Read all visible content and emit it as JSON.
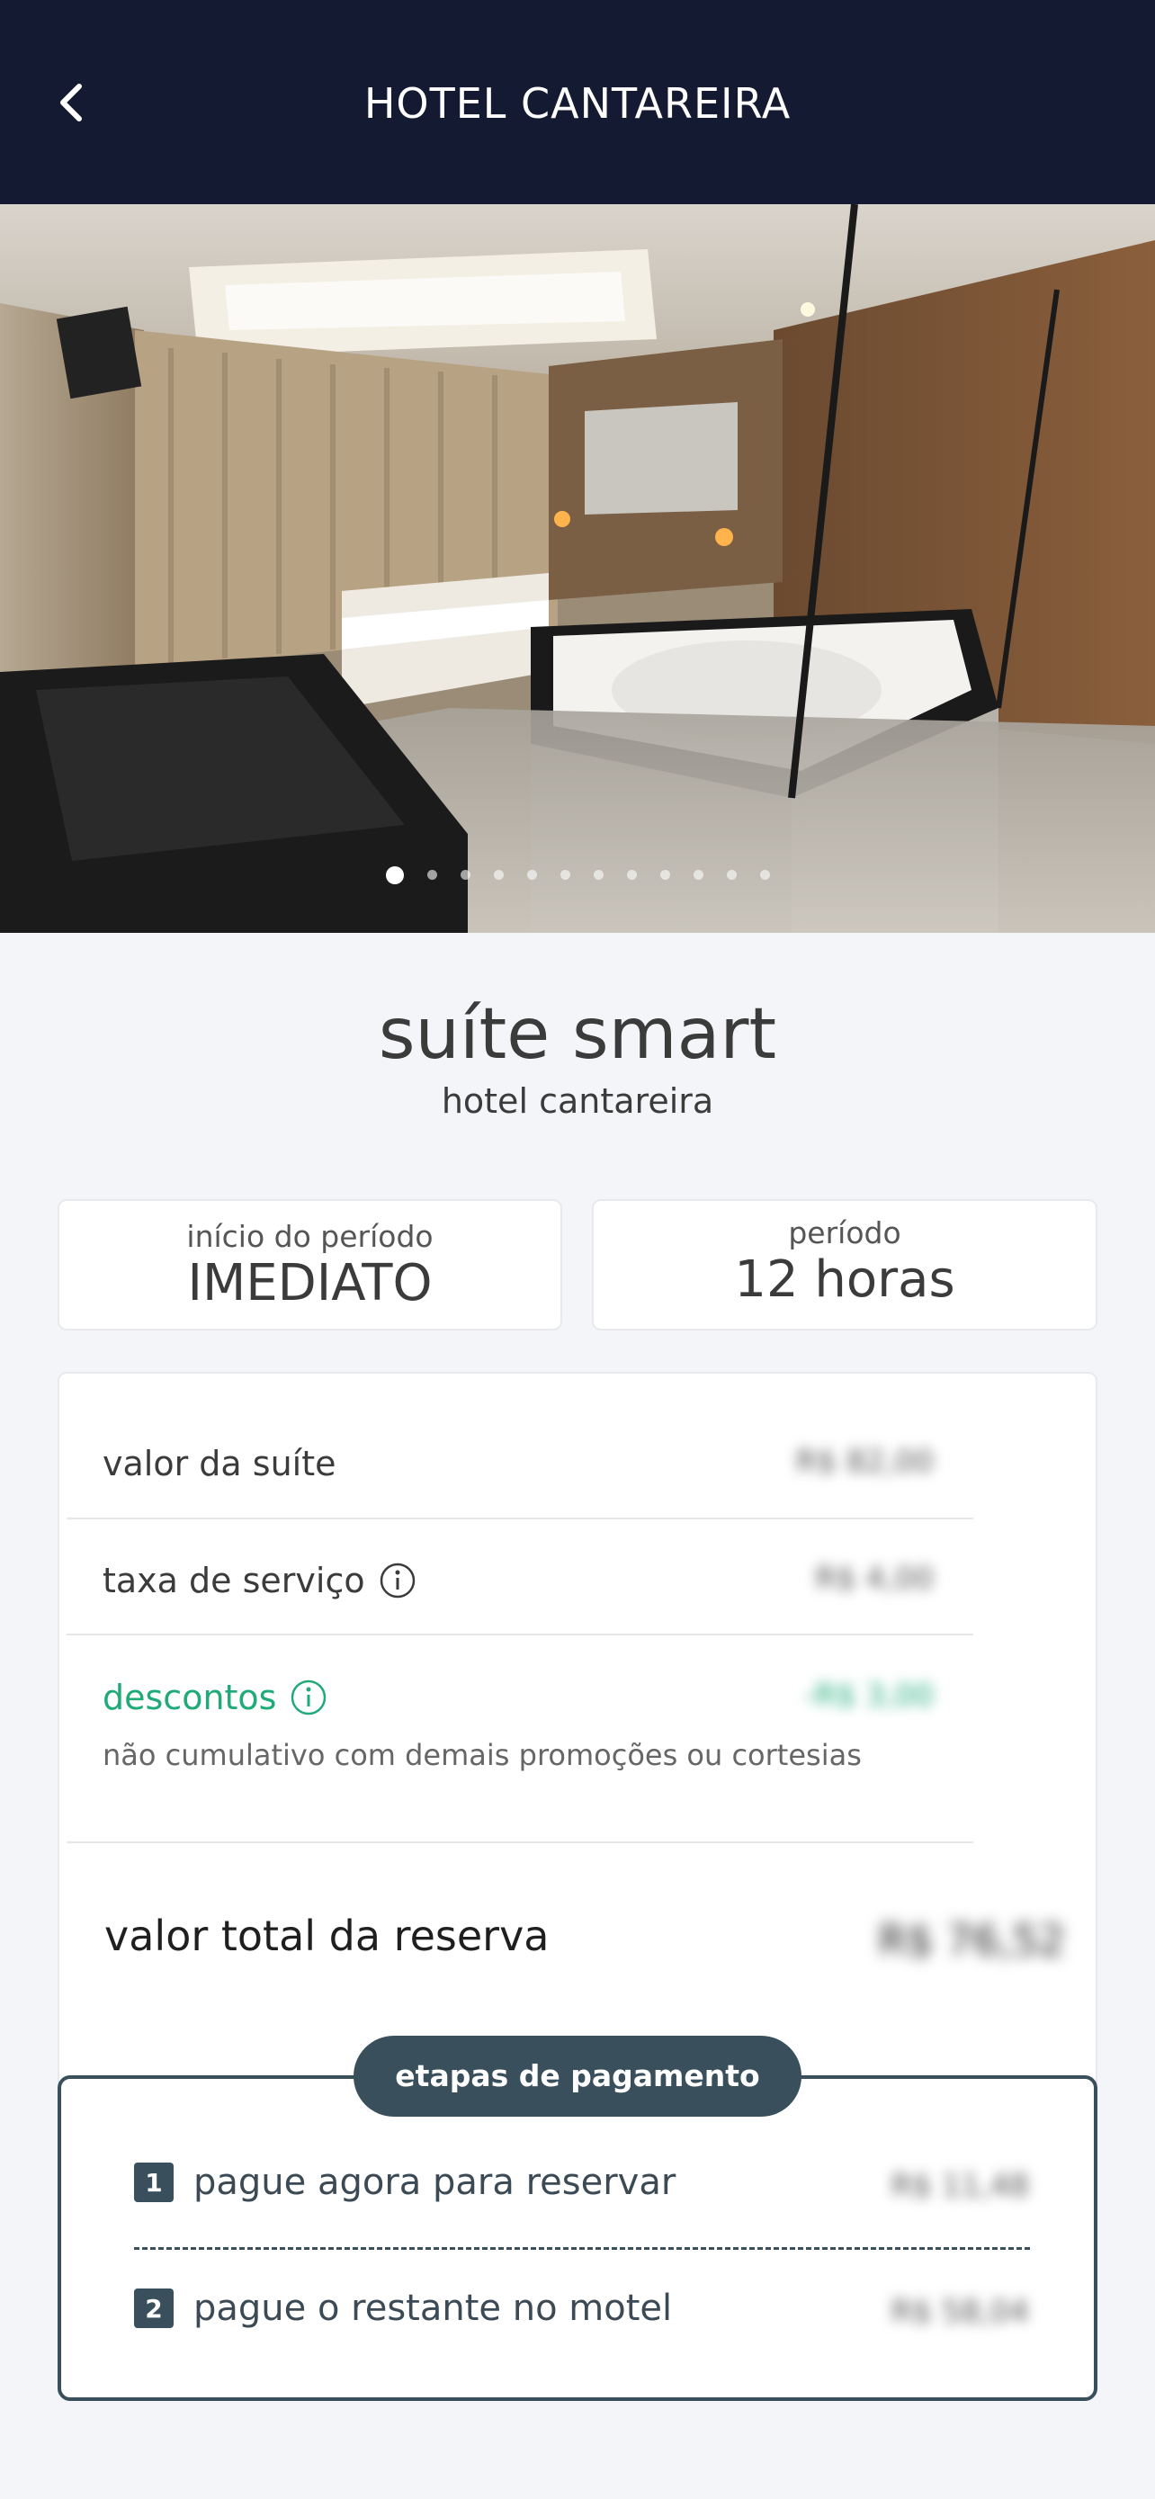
{
  "header": {
    "title": "HOTEL CANTAREIRA",
    "back_icon": "chevron-left-icon"
  },
  "gallery": {
    "slide_count": 12,
    "active_index": 0
  },
  "suite": {
    "name": "suíte smart",
    "hotel": "hotel cantareira"
  },
  "period": {
    "start_label": "início do período",
    "start_value": "IMEDIATO",
    "duration_label": "período",
    "duration_value": "12 horas"
  },
  "pricing": {
    "suite_value_label": "valor da suíte",
    "suite_value": "R$ 82,00",
    "service_fee_label": "taxa de serviço",
    "service_fee": "R$ 4,00",
    "discounts_label": "descontos",
    "discounts_value": "-R$ 3,00",
    "discounts_note": "não cumulativo com demais promoções ou cortesias",
    "total_label": "valor total da reserva",
    "total_value": "R$ 76,52"
  },
  "payment_steps": {
    "title": "etapas de pagamento",
    "steps": [
      {
        "number": "1",
        "label": "pague agora para reservar",
        "value": "R$ 11,48"
      },
      {
        "number": "2",
        "label": "pague o restante no motel",
        "value": "R$ 58,04"
      }
    ]
  },
  "colors": {
    "header_bg": "#141a31",
    "accent_green": "#1faa78",
    "steps_dark": "#3a4f5c"
  }
}
